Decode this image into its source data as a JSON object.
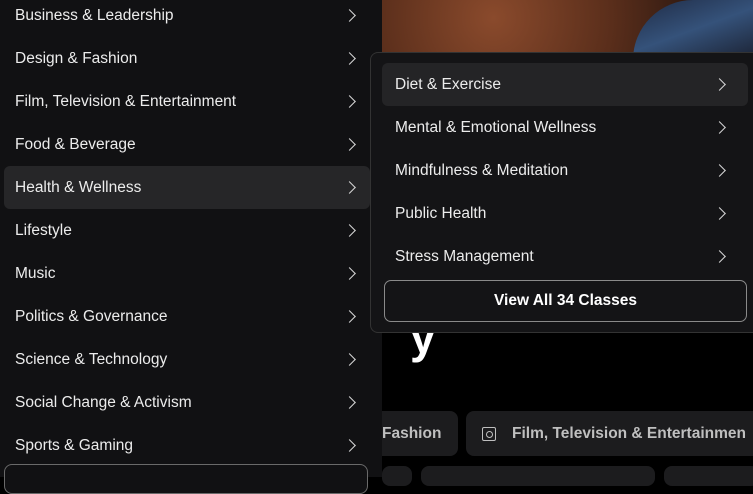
{
  "left_menu": {
    "items": [
      {
        "label": "Business & Leadership"
      },
      {
        "label": "Design & Fashion"
      },
      {
        "label": "Film, Television & Entertainment"
      },
      {
        "label": "Food & Beverage"
      },
      {
        "label": "Health & Wellness",
        "active": true
      },
      {
        "label": "Lifestyle"
      },
      {
        "label": "Music"
      },
      {
        "label": "Politics & Governance"
      },
      {
        "label": "Science & Technology"
      },
      {
        "label": "Social Change & Activism"
      },
      {
        "label": "Sports & Gaming"
      }
    ]
  },
  "submenu": {
    "items": [
      {
        "label": "Diet & Exercise",
        "active": true
      },
      {
        "label": "Mental & Emotional Wellness"
      },
      {
        "label": "Mindfulness & Meditation"
      },
      {
        "label": "Public Health"
      },
      {
        "label": "Stress Management"
      }
    ],
    "view_all_label": "View All 34 Classes"
  },
  "hero": {
    "partial_text": "y"
  },
  "chips": {
    "fashion_label": "Fashion",
    "film_label": "Film, Television & Entertainmen"
  },
  "colors": {
    "panel": "#111113",
    "active": "#262628",
    "background": "#000000"
  }
}
